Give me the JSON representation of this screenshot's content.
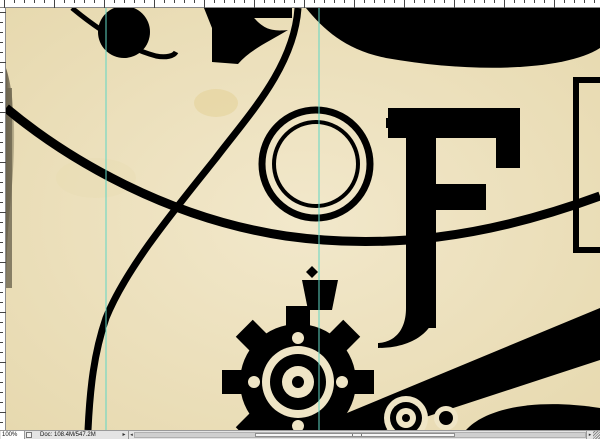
{
  "status_bar": {
    "zoom": "100%",
    "doc_info": "Doc: 108.4M/547.2M",
    "info_menu_glyph": "▸",
    "scroll_left_glyph": "◂",
    "scroll_right_glyph": "▸"
  },
  "artwork": {
    "paper_color": "#efe5c6",
    "ink_color": "#000000",
    "guide_color": "#5fd6c4",
    "letter": "F"
  },
  "icons": {
    "navigator": "navigator-icon",
    "resize": "resize-grip-icon"
  }
}
